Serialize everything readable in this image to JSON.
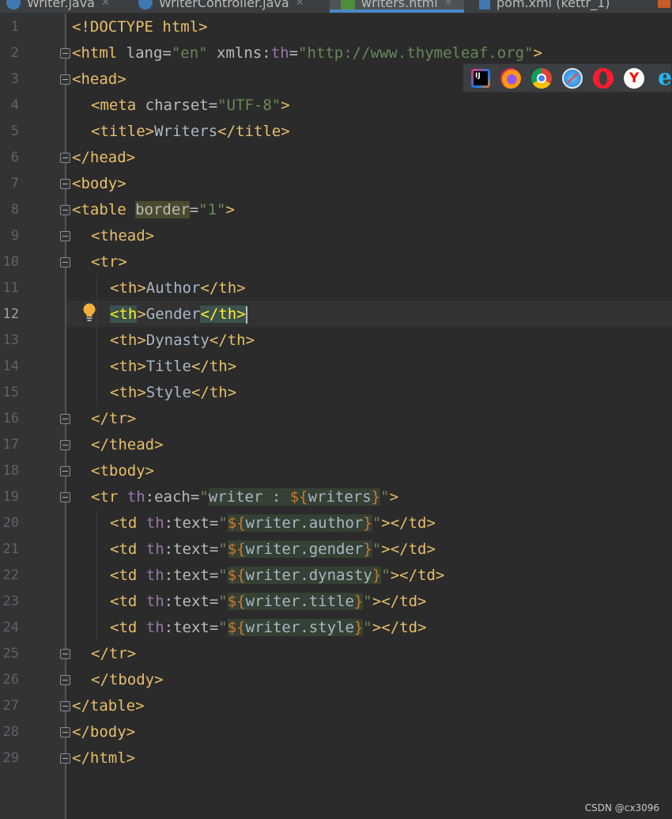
{
  "tabs": [
    {
      "label": "Writer.java",
      "active": false
    },
    {
      "label": "WriterController.java",
      "active": false
    },
    {
      "label": "writers.html",
      "active": true
    },
    {
      "label": "pom.xml (kettr_1)",
      "active": false
    }
  ],
  "editor": {
    "current_line": 12,
    "line_numbers": [
      "1",
      "2",
      "3",
      "4",
      "5",
      "6",
      "7",
      "8",
      "9",
      "10",
      "11",
      "12",
      "13",
      "14",
      "15",
      "16",
      "17",
      "18",
      "19",
      "20",
      "21",
      "22",
      "23",
      "24",
      "25",
      "26",
      "27",
      "28",
      "29"
    ],
    "tokens": {
      "l1": [
        "<!DOCTYPE html>"
      ],
      "l2": [
        "<html ",
        "lang=",
        "\"en\"",
        " xmlns",
        ":",
        "th",
        "=",
        "\"http://www.thymeleaf.org\"",
        ">"
      ],
      "l3": [
        "<head>"
      ],
      "l4": [
        "<meta ",
        "charset=",
        "\"UTF-8\"",
        ">"
      ],
      "l5": [
        "<title>",
        "Writers",
        "</title>"
      ],
      "l6": [
        "</head>"
      ],
      "l7": [
        "<body>"
      ],
      "l8": [
        "<table ",
        "border",
        "=",
        "\"1\"",
        ">"
      ],
      "l9": [
        "<thead>"
      ],
      "l10": [
        "<tr>"
      ],
      "l11": [
        "<th>",
        "Author",
        "</th>"
      ],
      "l12": [
        "<",
        "th",
        ">",
        "Gender",
        "</th",
        ">"
      ],
      "l13": [
        "<th>",
        "Dynasty",
        "</th>"
      ],
      "l14": [
        "<th>",
        "Title",
        "</th>"
      ],
      "l15": [
        "<th>",
        "Style",
        "</th>"
      ],
      "l16": [
        "</tr>"
      ],
      "l17": [
        "</thead>"
      ],
      "l18": [
        "<tbody>"
      ],
      "l19": [
        "<tr ",
        "th",
        ":each=",
        "\"",
        "writer : ",
        "${",
        "writers",
        "}",
        "\"",
        ">"
      ],
      "l20": [
        "<td ",
        "th",
        ":text=",
        "\"",
        "${",
        "writer.author",
        "}",
        "\"",
        "></td>"
      ],
      "l21": [
        "<td ",
        "th",
        ":text=",
        "\"",
        "${",
        "writer.gender",
        "}",
        "\"",
        "></td>"
      ],
      "l22": [
        "<td ",
        "th",
        ":text=",
        "\"",
        "${",
        "writer.dynasty",
        "}",
        "\"",
        "></td>"
      ],
      "l23": [
        "<td ",
        "th",
        ":text=",
        "\"",
        "${",
        "writer.title",
        "}",
        "\"",
        "></td>"
      ],
      "l24": [
        "<td ",
        "th",
        ":text=",
        "\"",
        "${",
        "writer.style",
        "}",
        "\"",
        "></td>"
      ],
      "l25": [
        "</tr>"
      ],
      "l26": [
        "</tbody>"
      ],
      "l27": [
        "</table>"
      ],
      "l28": [
        "</body>"
      ],
      "l29": [
        "</html>"
      ]
    }
  },
  "browser_icons": [
    "intellij-icon",
    "firefox-icon",
    "chrome-icon",
    "safari-icon",
    "opera-icon",
    "yandex-icon",
    "edge-icon"
  ],
  "browser_icon_labels": {
    "intellij": "IJ",
    "yandex": "Y",
    "edge": "e"
  },
  "watermark": "CSDN @cx3096",
  "colors": {
    "background": "#2b2b2b",
    "gutter": "#313335",
    "tag": "#e8bf6a",
    "string": "#6a8759",
    "namespace": "#9876aa",
    "active_tab_underline": "#4a88c7"
  }
}
